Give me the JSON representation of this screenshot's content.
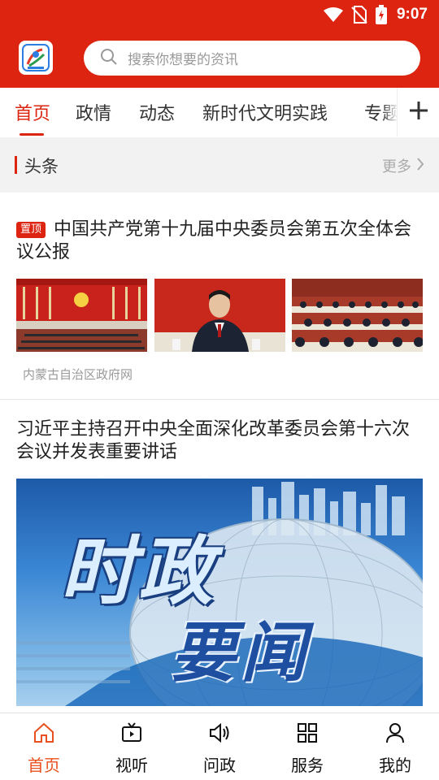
{
  "status_bar": {
    "time": "9:07"
  },
  "search": {
    "placeholder": "搜索你想要的资讯"
  },
  "tabs": [
    {
      "label": "首页",
      "active": true
    },
    {
      "label": "政情",
      "active": false
    },
    {
      "label": "动态",
      "active": false
    },
    {
      "label": "新时代文明实践",
      "active": false
    },
    {
      "label": "专题",
      "active": false
    }
  ],
  "section": {
    "title": "头条",
    "more_label": "更多"
  },
  "news": [
    {
      "pinned_label": "置顶",
      "title": "中国共产党第十九届中央委员会第五次全体会议公报",
      "source": "内蒙古自治区政府网"
    },
    {
      "title": "习近平主持召开中央全面深化改革委员会第十六次会议并发表重要讲话",
      "banner_text_1": "时政",
      "banner_text_2": "要闻"
    }
  ],
  "bottom_nav": [
    {
      "label": "首页",
      "icon": "home-icon",
      "active": true
    },
    {
      "label": "视听",
      "icon": "tv-icon",
      "active": false
    },
    {
      "label": "问政",
      "icon": "speaker-icon",
      "active": false
    },
    {
      "label": "服务",
      "icon": "grid-icon",
      "active": false
    },
    {
      "label": "我的",
      "icon": "user-icon",
      "active": false
    }
  ],
  "colors": {
    "brand": "#dc2410",
    "nav_active": "#e8501f"
  }
}
